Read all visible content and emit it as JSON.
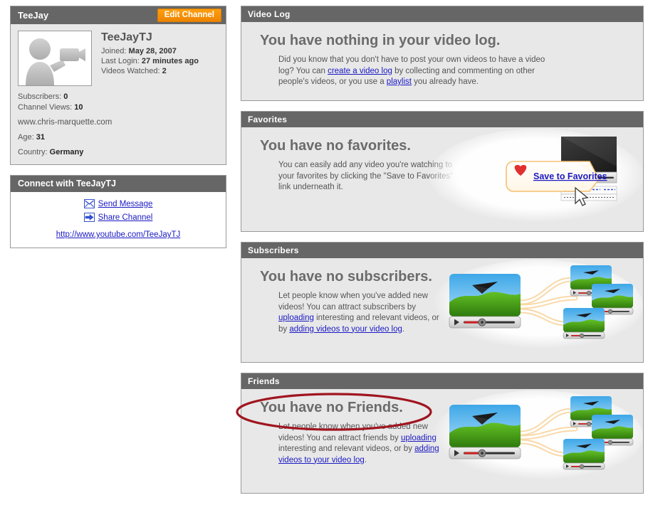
{
  "profile": {
    "channel_title": "TeeJay",
    "edit_button": "Edit Channel",
    "username": "TeeJayTJ",
    "joined_label": "Joined:",
    "joined_value": "May 28, 2007",
    "last_login_label": "Last Login:",
    "last_login_value": "27 minutes ago",
    "videos_watched_label": "Videos Watched:",
    "videos_watched_value": "2",
    "subscribers_label": "Subscribers:",
    "subscribers_value": "0",
    "channel_views_label": "Channel Views:",
    "channel_views_value": "10",
    "website": "www.chris-marquette.com",
    "age_label": "Age:",
    "age_value": "31",
    "country_label": "Country:",
    "country_value": "Germany",
    "avatar_icon": "person-with-camcorder-icon"
  },
  "connect": {
    "header": "Connect with TeeJayTJ",
    "send_message": "Send Message",
    "send_message_icon": "envelope-icon",
    "share_channel": "Share Channel",
    "share_channel_icon": "arrow-right-icon",
    "channel_url": "http://www.youtube.com/TeeJayTJ"
  },
  "panels": {
    "video_log": {
      "header": "Video Log",
      "heading": "You have nothing in your video log.",
      "body_1": "Did you know that you don't have to post your own videos to have a video log? You can ",
      "link_1": "create a video log",
      "body_2": " by collecting and commenting on other people's videos, or you use a ",
      "link_2": "playlist",
      "body_3": " you already have."
    },
    "favorites": {
      "header": "Favorites",
      "heading": "You have no favorites.",
      "body_1": "You can easily add any video you're watching to your favorites by clicking the \"Save to Favorites\" link underneath it.",
      "callout_label": "Save to Favorites",
      "callout_icon": "heart-icon",
      "illustration": "video-player-with-save-to-favorites-callout"
    },
    "subscribers": {
      "header": "Subscribers",
      "heading": "You have no subscribers.",
      "body_1": "Let people know when you've added new videos! You can attract subscribers by ",
      "link_1": "uploading",
      "body_2": " interesting and relevant videos, or by ",
      "link_2": "adding videos to your video log",
      "body_3": ".",
      "illustration": "hangglider-video-branching-to-three-videos"
    },
    "friends": {
      "header": "Friends",
      "heading": "You have no Friends.",
      "body_1": "Let people know when you've added new videos! You can attract friends by ",
      "link_1": "uploading",
      "body_2": " interesting and relevant videos, or by ",
      "link_2": "adding videos to your video log",
      "body_3": ".",
      "illustration": "hangglider-video-branching-to-three-videos"
    }
  },
  "annotation": {
    "shape": "ellipse",
    "color": "#a01520",
    "target": "You have no Friends."
  },
  "colors": {
    "panel_header": "#666666",
    "panel_body": "#e8e8e8",
    "accent_orange": "#f39000",
    "link_blue": "#1a19c4",
    "annotation_red": "#a01520"
  }
}
